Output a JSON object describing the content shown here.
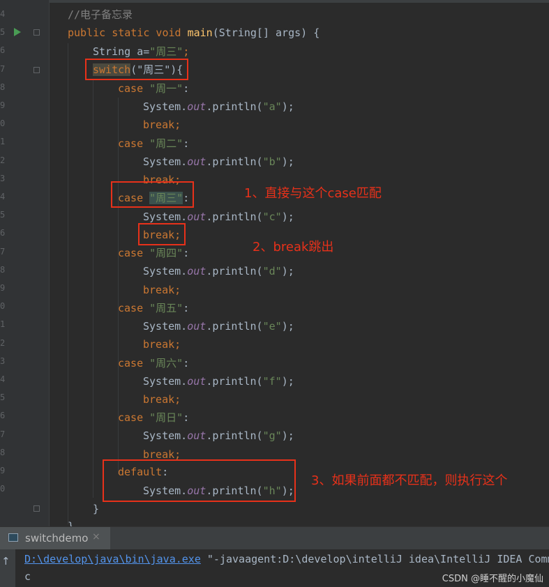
{
  "editor": {
    "line_numbers": [
      "4",
      "5",
      "6",
      "7",
      "8",
      "9",
      "0",
      "1",
      "2",
      "3",
      "4",
      "5",
      "6",
      "7",
      "8",
      "9",
      "0",
      "1",
      "2",
      "3",
      "4",
      "5",
      "6",
      "7",
      "8",
      "9",
      "0"
    ],
    "comment": "//电子备忘录",
    "method_sig": {
      "mods": "public static void ",
      "name": "main",
      "params": "(String[] args) {"
    },
    "decl": {
      "type": "String ",
      "var": "a",
      "eq": "=",
      "val": "\"周三\"",
      "end": ";"
    },
    "switch_kw": "switch",
    "switch_arg": "(\"周三\"){",
    "case_kw": "case",
    "break_kw": "break;",
    "default_kw": "default",
    "colon": ":",
    "sys": "System.",
    "out": "out",
    "println": ".println(",
    "close_paren": ");",
    "close_brace": "}",
    "cases": [
      {
        "label": "\"周一\"",
        "arg": "\"a\""
      },
      {
        "label": "\"周二\"",
        "arg": "\"b\""
      },
      {
        "label": "\"周三\"",
        "arg": "\"c\""
      },
      {
        "label": "\"周四\"",
        "arg": "\"d\""
      },
      {
        "label": "\"周五\"",
        "arg": "\"e\""
      },
      {
        "label": "\"周六\"",
        "arg": "\"f\""
      },
      {
        "label": "\"周日\"",
        "arg": "\"g\""
      }
    ],
    "default_arg": "\"h\""
  },
  "annotations": {
    "a1": "1、直接与这个case匹配",
    "a2": "2、break跳出",
    "a3": "3、如果前面都不匹配，则执行这个"
  },
  "run_panel": {
    "tab_label": "switchdemo",
    "tab_close": "×",
    "cmd_link": "D:\\develop\\java\\bin\\java.exe",
    "cmd_rest": " \"-javaagent:D:\\develop\\intelliJ idea\\IntelliJ IDEA Comm",
    "output": "c"
  },
  "watermark": "CSDN @睡不醒的小魔仙",
  "colors": {
    "accent_red": "#e8311a",
    "keyword": "#cc7832",
    "string": "#6a8759"
  }
}
